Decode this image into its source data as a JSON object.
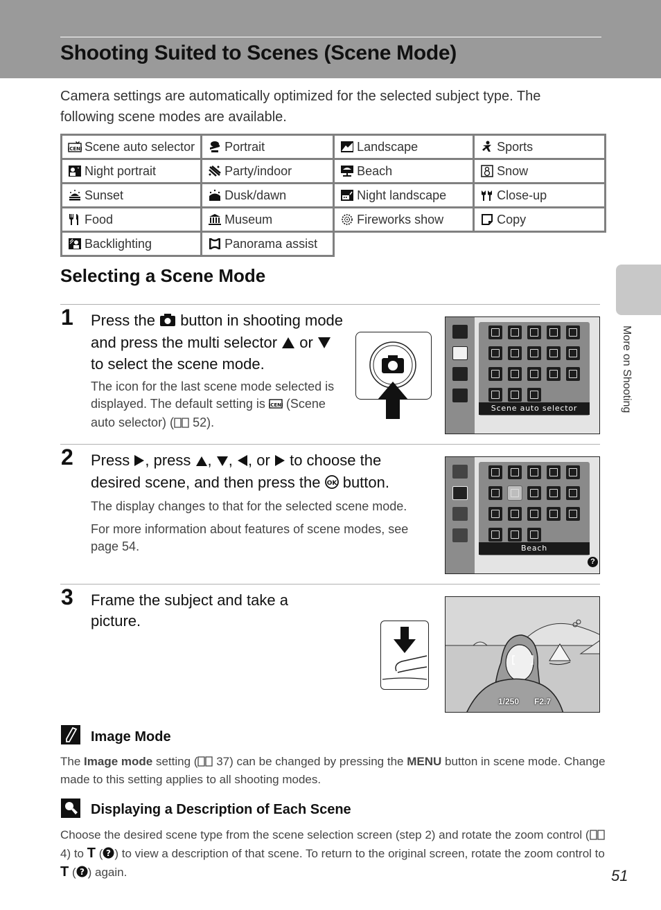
{
  "header": {
    "title": "Shooting Suited to Scenes (Scene Mode)"
  },
  "intro": "Camera settings are automatically optimized for the selected subject type. The following scene modes are available.",
  "scene_table": {
    "rows": [
      [
        {
          "icon": "scene-auto-icon",
          "label": "Scene auto selector"
        },
        {
          "icon": "portrait-icon",
          "label": "Portrait"
        },
        {
          "icon": "landscape-icon",
          "label": "Landscape"
        },
        {
          "icon": "sports-icon",
          "label": "Sports"
        }
      ],
      [
        {
          "icon": "night-portrait-icon",
          "label": "Night portrait"
        },
        {
          "icon": "party-indoor-icon",
          "label": "Party/indoor"
        },
        {
          "icon": "beach-icon",
          "label": "Beach"
        },
        {
          "icon": "snow-icon",
          "label": "Snow"
        }
      ],
      [
        {
          "icon": "sunset-icon",
          "label": "Sunset"
        },
        {
          "icon": "dusk-dawn-icon",
          "label": "Dusk/dawn"
        },
        {
          "icon": "night-landscape-icon",
          "label": "Night landscape"
        },
        {
          "icon": "close-up-icon",
          "label": "Close-up"
        }
      ],
      [
        {
          "icon": "food-icon",
          "label": "Food"
        },
        {
          "icon": "museum-icon",
          "label": "Museum"
        },
        {
          "icon": "fireworks-icon",
          "label": "Fireworks show"
        },
        {
          "icon": "copy-icon",
          "label": "Copy"
        }
      ],
      [
        {
          "icon": "backlighting-icon",
          "label": "Backlighting"
        },
        {
          "icon": "panorama-assist-icon",
          "label": "Panorama assist"
        }
      ]
    ]
  },
  "section_title": "Selecting a Scene Mode",
  "steps": [
    {
      "number": "1",
      "heading_parts": [
        "Press the",
        "button in shooting mode and press the multi selector",
        "or",
        "to select the scene mode."
      ],
      "body_parts": [
        "The icon for the last scene mode selected is displayed. The default setting is",
        "(Scene auto selector) (",
        "52)."
      ],
      "screen_caption": "Scene auto selector"
    },
    {
      "number": "2",
      "heading_parts": [
        "Press",
        ", press",
        ",",
        ",",
        ", or",
        "to choose the desired scene, and then press the",
        "button."
      ],
      "body": [
        "The display changes to that for the selected scene mode.",
        "For more information about features of scene modes, see page 54."
      ],
      "screen_caption": "Beach"
    },
    {
      "number": "3",
      "heading": "Frame the subject and take a picture.",
      "shutter_speed": "1/250",
      "aperture": "F2.7"
    }
  ],
  "notes": [
    {
      "title": "Image Mode",
      "body_parts": [
        "The",
        "Image mode",
        "setting (",
        "37) can be changed by pressing the",
        "MENU",
        "button in scene mode. Change made to this setting applies to all shooting modes."
      ]
    },
    {
      "title": "Displaying a Description of Each Scene",
      "body_parts": [
        "Choose the desired scene type from the scene selection screen (step 2) and rotate the zoom control (",
        "4) to",
        "T",
        "(",
        ") to view a description of that scene. To return to the original screen, rotate the zoom control to",
        "T",
        "(",
        ") again."
      ]
    }
  ],
  "side_tab": {
    "label": "More on Shooting"
  },
  "page_number": "51"
}
